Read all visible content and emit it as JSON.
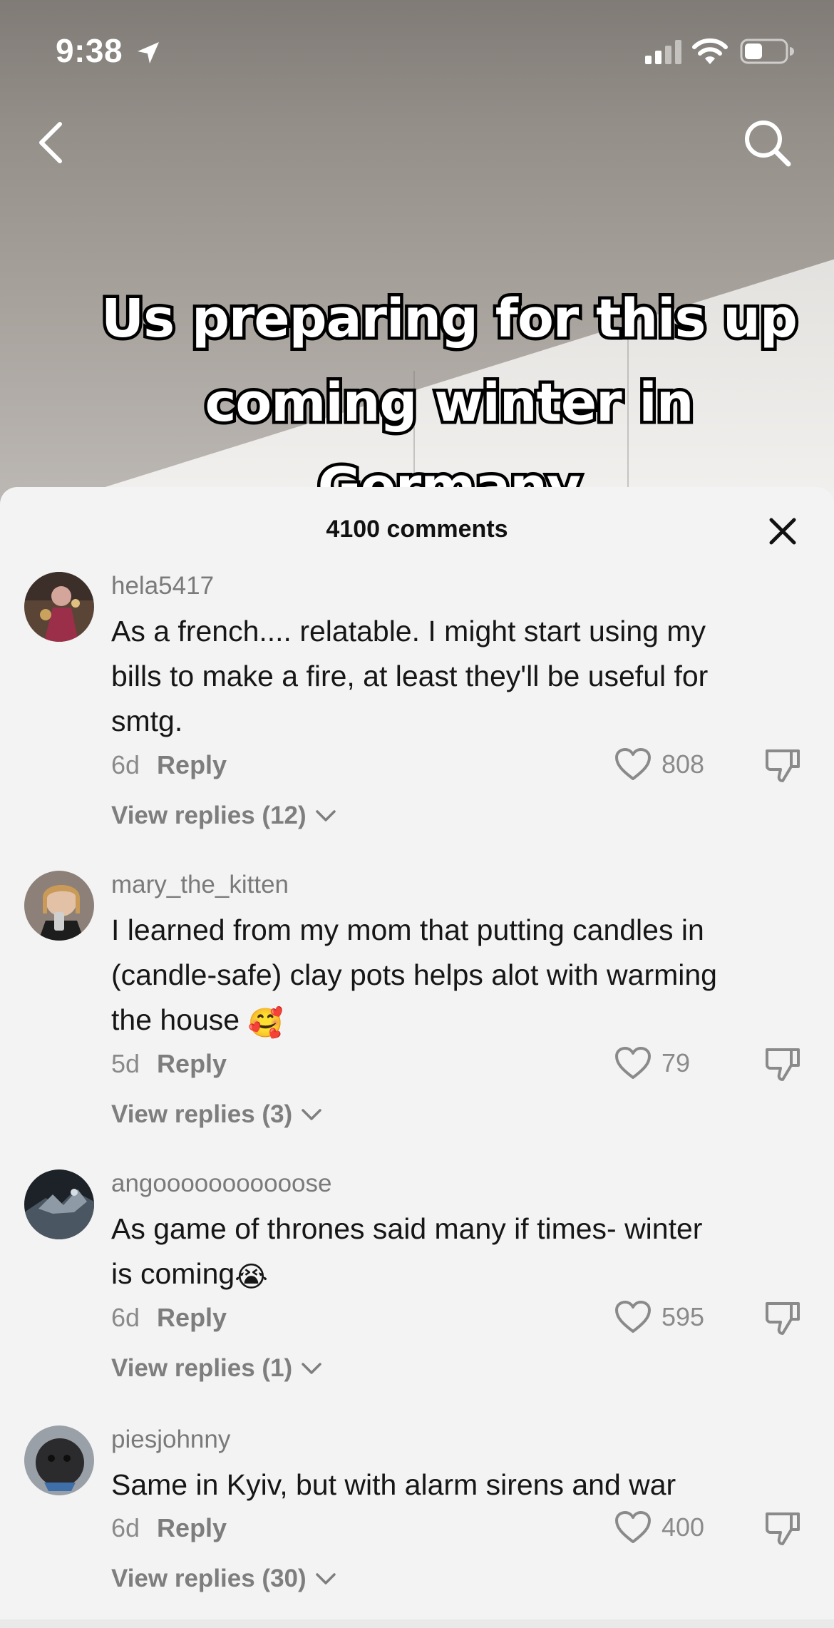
{
  "status_bar": {
    "time": "9:38"
  },
  "video": {
    "caption_lines": [
      "Us preparing for this up",
      "coming winter in",
      "Germany"
    ]
  },
  "comments_sheet": {
    "title": "4100 comments",
    "comments": [
      {
        "username": "hela5417",
        "text": "As a french.... relatable. I might start using my bills to make a fire, at least they'll be useful for smtg.",
        "emoji": "",
        "age": "6d",
        "reply_label": "Reply",
        "likes": "808",
        "view_replies": "View replies (12)",
        "avatar_color": "#6b3b4a"
      },
      {
        "username": "mary_the_kitten",
        "text": "I learned from my mom that putting candles in (candle-safe) clay pots helps alot with warming the house",
        "emoji": "🥰",
        "age": "5d",
        "reply_label": "Reply",
        "likes": "79",
        "view_replies": "View replies (3)",
        "avatar_color": "#c9a88a"
      },
      {
        "username": "angooooooooooose",
        "text": "As game of thrones said many if times- winter is coming",
        "emoji": "😭",
        "age": "6d",
        "reply_label": "Reply",
        "likes": "595",
        "view_replies": "View replies (1)",
        "avatar_color": "#2f3a45"
      },
      {
        "username": "piesjohnny",
        "text": "Same in Kyiv, but with alarm sirens and war",
        "emoji": "",
        "age": "6d",
        "reply_label": "Reply",
        "likes": "400",
        "view_replies": "View replies (30)",
        "avatar_color": "#3d3d40"
      }
    ]
  }
}
